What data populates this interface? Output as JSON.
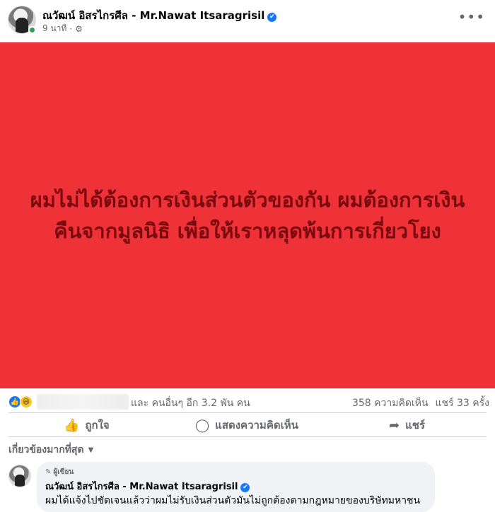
{
  "post": {
    "author": "ณวัฒน์ อิสรไกรศีล - Mr.Nawat Itsaragrisil",
    "time": "9 นาที",
    "separator": "·",
    "verified_icon": "✔",
    "gear_icon": "⚙",
    "more_icon": "•••",
    "message": "ผมไม่ได้ต้องการเงินส่วนตัวของกัน ผมต้องการเงินคืนจากมูลนิธิ เพื่อให้เราหลุดพ้นการเกี่ยวโยง",
    "card_color": "#ee3237",
    "text_color": "#7a0a0e"
  },
  "reactions": {
    "icons": [
      "like-icon",
      "haha-icon"
    ],
    "like_glyph": "👍",
    "haha_glyph": "😆",
    "others": "และ คนอื่นๆ อีก 3.2 พัน คน",
    "comments": "358 ความคิดเห็น",
    "shares": "แชร์ 33 ครั้ง"
  },
  "actions": {
    "like": "ถูกใจ",
    "comment": "แสดงความคิดเห็น",
    "share": "แชร์",
    "like_glyph": "👍",
    "comment_glyph": "◯",
    "share_glyph": "➦"
  },
  "filter": {
    "label": "เกี่ยวข้องมากที่สุด",
    "chevron": "▼"
  },
  "comment": {
    "badge": "ผู้เขียน",
    "pencil_glyph": "✎",
    "author": "ณวัฒน์ อิสรไกรศีล - Mr.Nawat Itsaragrisil",
    "verified_icon": "✔",
    "text": "ผมได้แจ้งไปชัดเจนแล้วว่าผมไม่รับเงินส่วนตัวมันไม่ถูกต้องตามกฎหมายของบริษัทมหาชน"
  }
}
